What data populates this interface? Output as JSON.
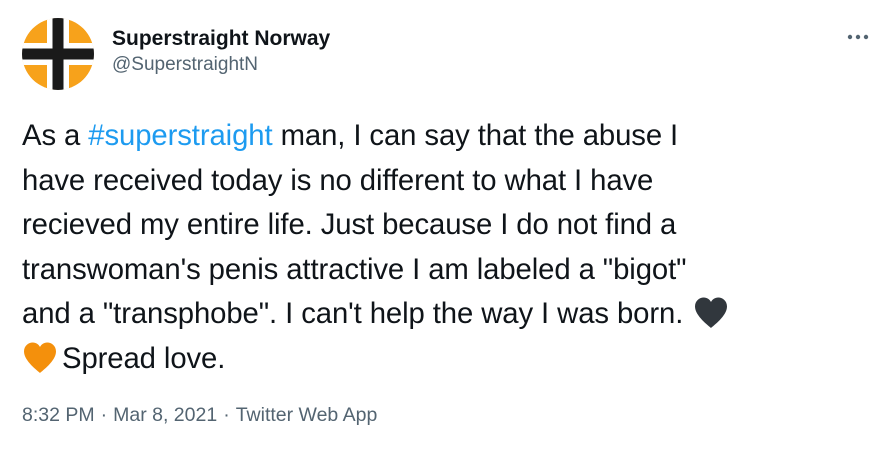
{
  "author": {
    "display_name": "Superstraight Norway",
    "handle": "@SuperstraightN",
    "avatar_icon": "norwegian-cross-flag-icon",
    "avatar_colors": {
      "field": "#f7a21b",
      "cross_outer": "#ffffff",
      "cross_inner": "#1a1a1a"
    }
  },
  "menu": {
    "more_icon": "more-options-icon"
  },
  "tweet": {
    "lines": [
      {
        "before": "As a ",
        "hashtag": "#superstraight",
        "after": " man, I can say that the abuse I"
      },
      {
        "text": "have received today is no different to what I have"
      },
      {
        "text": "recieved my entire life. Just because I do not find a"
      },
      {
        "text": "transwoman's penis attractive I am labeled a \"bigot\""
      },
      {
        "text": "and a \"transphobe\". I can't help the way I was born."
      },
      {
        "text": "Spread love."
      }
    ],
    "emojis": [
      {
        "name": "black-heart-icon",
        "color": "#31373d"
      },
      {
        "name": "orange-heart-icon",
        "color": "#f4900c"
      }
    ],
    "hashtag_color": "#1d9bf0"
  },
  "meta": {
    "time": "8:32 PM",
    "separator": "·",
    "date": "Mar 8, 2021",
    "source": "Twitter Web App"
  }
}
